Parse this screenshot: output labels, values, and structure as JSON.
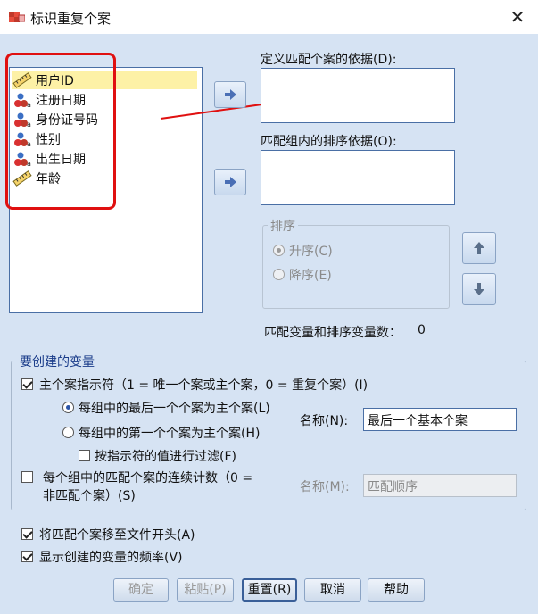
{
  "window": {
    "title": "标识重复个案",
    "close_symbol": "✕"
  },
  "variables": [
    {
      "label": "用户ID",
      "icon": "ruler-icon",
      "selected": true
    },
    {
      "label": "注册日期",
      "icon": "nominal-icon"
    },
    {
      "label": "身份证号码",
      "icon": "nominal-icon"
    },
    {
      "label": "性别",
      "icon": "nominal-icon"
    },
    {
      "label": "出生日期",
      "icon": "nominal-icon"
    },
    {
      "label": "年龄",
      "icon": "ruler-icon"
    }
  ],
  "define_match": {
    "label": "定义匹配个案的依据(D):"
  },
  "sort_within": {
    "label": "匹配组内的排序依据(O):"
  },
  "sort_order": {
    "legend": "排序",
    "ascending": "升序(C)",
    "descending": "降序(E)"
  },
  "count_text": "匹配变量和排序变量数：",
  "count_value": "0",
  "create_group": {
    "legend": "要创建的变量",
    "primary_indicator": "主个案指示符（1 = 唯一个案或主个案，0 = 重复个案）(I)",
    "last_case": "每组中的最后一个个案为主个案(L)",
    "first_case": "每组中的第一个个案为主个案(H)",
    "filter": "按指示符的值进行过滤(F)",
    "name_label": "名称(N):",
    "name_value": "最后一个基本个案",
    "sequential_line1": "每个组中的匹配个案的连续计数（0 =",
    "sequential_line2": "非匹配个案）(S)",
    "name2_label": "名称(M):",
    "name2_value": "匹配顺序"
  },
  "move_to_top": "将匹配个案移至文件开头(A)",
  "show_freq": "显示创建的变量的频率(V)",
  "buttons": {
    "ok": "确定",
    "paste": "粘贴(P)",
    "reset": "重置(R)",
    "cancel": "取消",
    "help": "帮助"
  },
  "colors": {
    "panel": "#d6e3f3",
    "selection": "#fdf1a6",
    "annotation": "#e01010",
    "accent": "#2b55a8"
  }
}
